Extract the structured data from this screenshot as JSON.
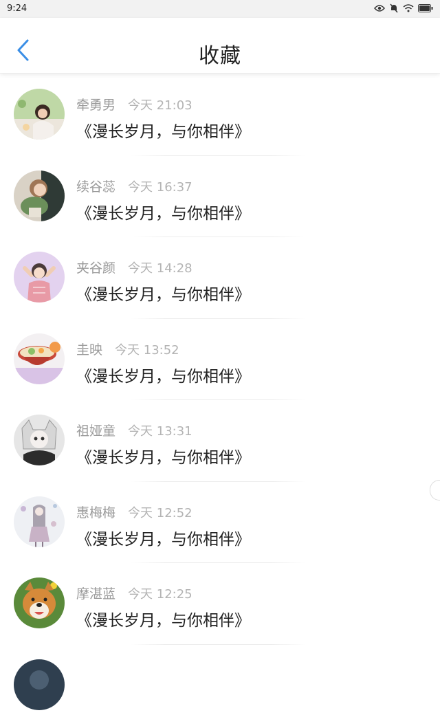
{
  "status": {
    "time": "9:24"
  },
  "header": {
    "title": "收藏"
  },
  "items": [
    {
      "name": "牵勇男",
      "time": "今天 21:03",
      "title": "《漫长岁月，与你相伴》"
    },
    {
      "name": "续谷蕊",
      "time": "今天 16:37",
      "title": "《漫长岁月，与你相伴》"
    },
    {
      "name": "夹谷颜",
      "time": "今天 14:28",
      "title": "《漫长岁月，与你相伴》"
    },
    {
      "name": "圭映",
      "time": "今天 13:52",
      "title": "《漫长岁月，与你相伴》"
    },
    {
      "name": "祖娅童",
      "time": "今天 13:31",
      "title": "《漫长岁月，与你相伴》"
    },
    {
      "name": "惠梅梅",
      "time": "今天 12:52",
      "title": "《漫长岁月，与你相伴》"
    },
    {
      "name": "摩湛蓝",
      "time": "今天 12:25",
      "title": "《漫长岁月，与你相伴》"
    },
    {
      "name": "",
      "time": "",
      "title": ""
    }
  ],
  "icons": {
    "back": "chevron-left-icon",
    "status": [
      "eye-icon",
      "mute-icon",
      "wifi-icon",
      "battery-icon"
    ]
  },
  "colors": {
    "accent": "#3a8ee6"
  }
}
